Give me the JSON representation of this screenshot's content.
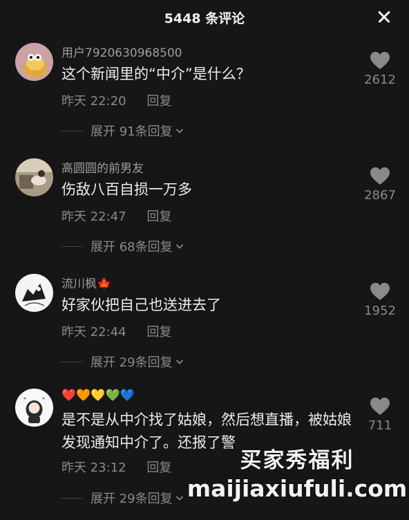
{
  "header": {
    "title": "5448 条评论"
  },
  "comments": [
    {
      "username": "用户7920630968500",
      "text": "这个新闻里的“中介”是什么？",
      "time": "昨天 22:20",
      "reply_label": "回复",
      "expand_label": "展开 91条回复",
      "likes": "2612"
    },
    {
      "username": "高圆圆的前男友",
      "text": "伤敌八百自损一万多",
      "time": "昨天 22:47",
      "reply_label": "回复",
      "expand_label": "展开 68条回复",
      "likes": "2867"
    },
    {
      "username": "流川枫🍁",
      "text": "好家伙把自己也送进去了",
      "time": "昨天 22:44",
      "reply_label": "回复",
      "expand_label": "展开 29条回复",
      "likes": "1952"
    },
    {
      "username": "❤️🧡💛💚💙",
      "text": "是不是从中介找了姑娘，然后想直播，被姑娘发现通知中介了。还报了警",
      "time": "昨天 23:12",
      "reply_label": "回复",
      "expand_label": "展开 29条回复",
      "likes": "711"
    }
  ],
  "watermark": {
    "cn": "买家秀福利",
    "en": "maijiaxiufuli.com"
  },
  "icons": {
    "close": "close-icon",
    "like": "heart-icon",
    "expand": "chevron-down-icon"
  },
  "colors": {
    "background": "#161616",
    "muted_text": "#8a8a8a",
    "primary_text": "#ededed"
  }
}
